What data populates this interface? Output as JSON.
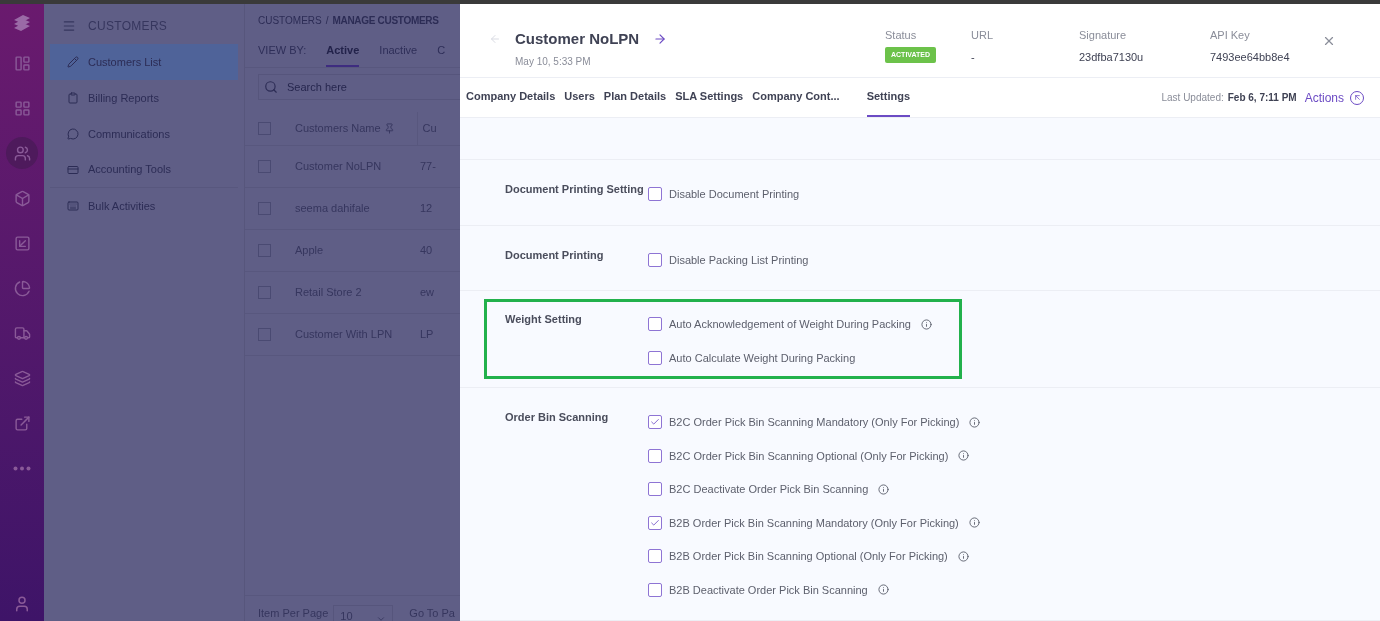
{
  "rail": {
    "items": [
      {
        "selected": false
      },
      {
        "selected": false
      },
      {
        "selected": true
      },
      {
        "selected": false
      },
      {
        "selected": false
      },
      {
        "selected": false
      },
      {
        "selected": false
      },
      {
        "selected": false
      },
      {
        "selected": false
      },
      {
        "selected": false
      }
    ]
  },
  "sidebar": {
    "title": "CUSTOMERS",
    "items": [
      {
        "label": "Customers List",
        "selected": true
      },
      {
        "label": "Billing Reports",
        "selected": false
      },
      {
        "label": "Communications",
        "selected": false
      },
      {
        "label": "Accounting Tools",
        "selected": false
      },
      {
        "label": "Bulk Activities",
        "selected": false
      }
    ]
  },
  "list": {
    "breadcrumb": [
      "CUSTOMERS",
      "/",
      "MANAGE CUSTOMERS"
    ],
    "select_all": false,
    "view_by": "VIEW BY:",
    "tabs": [
      {
        "label": "Active",
        "selected": true
      },
      {
        "label": "Inactive",
        "selected": false
      },
      {
        "label": "C",
        "selected": false
      }
    ],
    "search": {
      "placeholder": "Search here"
    },
    "columns": [
      "Customers Name",
      "Cu"
    ],
    "rows": [
      {
        "name": "Customer NoLPN",
        "column_2": "77-",
        "checked": false
      },
      {
        "name": "seema dahifale",
        "column_2": "12",
        "checked": false
      },
      {
        "name": "Apple",
        "column_2": "40",
        "checked": false
      },
      {
        "name": "Retail Store 2",
        "column_2": "ew",
        "checked": false
      },
      {
        "name": "Customer With LPN",
        "column_2": "LP",
        "checked": false
      }
    ],
    "footer": {
      "per_page_label": "Item Per Page",
      "per_page": "10",
      "go_to": "Go To Pa"
    }
  },
  "drawer": {
    "title": "Customer NoLPN",
    "date": "May 10, 5:33 PM",
    "fields": [
      {
        "label": "Status",
        "value": "ACTIVATED",
        "kind": "badge"
      },
      {
        "label": "URL",
        "value": "-",
        "kind": "text"
      },
      {
        "label": "Signature",
        "value": "23dfba7130u",
        "kind": "text"
      },
      {
        "label": "API Key",
        "value": "7493ee64bb8e4",
        "kind": "text"
      }
    ],
    "tabs": [
      {
        "label": "Company Details",
        "selected": false
      },
      {
        "label": "Users",
        "selected": false
      },
      {
        "label": "Plan Details",
        "selected": false
      },
      {
        "label": "SLA Settings",
        "selected": false
      },
      {
        "label": "Company Cont...",
        "selected": false
      },
      {
        "label": "Settings",
        "selected": true
      }
    ],
    "last_updated_label": "Last Updated:",
    "last_updated": "Feb 6, 7:11 PM",
    "actions": "Actions",
    "sections": [
      {
        "label": "Document Printing Setting",
        "highlighted": false,
        "options": [
          {
            "label": "Disable Document Printing",
            "checked": false,
            "info": false
          }
        ]
      },
      {
        "label": "Document Printing",
        "highlighted": false,
        "options": [
          {
            "label": "Disable Packing List Printing",
            "checked": false,
            "info": false
          }
        ]
      },
      {
        "label": "Weight Setting",
        "highlighted": true,
        "options": [
          {
            "label": "Auto Acknowledgement of Weight During Packing",
            "checked": false,
            "info": true
          },
          {
            "label": "Auto Calculate Weight During Packing",
            "checked": false,
            "info": false
          }
        ]
      },
      {
        "label": "Order Bin Scanning",
        "highlighted": false,
        "options": [
          {
            "label": "B2C Order Pick Bin Scanning Mandatory (Only For Picking)",
            "checked": true,
            "info": true
          },
          {
            "label": "B2C Order Pick Bin Scanning Optional (Only For Picking)",
            "checked": false,
            "info": true
          },
          {
            "label": "B2C Deactivate Order Pick Bin Scanning",
            "checked": false,
            "info": true
          },
          {
            "label": "B2B Order Pick Bin Scanning Mandatory (Only For Picking)",
            "checked": true,
            "info": true
          },
          {
            "label": "B2B Order Pick Bin Scanning Optional (Only For Picking)",
            "checked": false,
            "info": true
          },
          {
            "label": "B2B Deactivate Order Pick Bin Scanning",
            "checked": false,
            "info": true
          }
        ]
      }
    ]
  }
}
